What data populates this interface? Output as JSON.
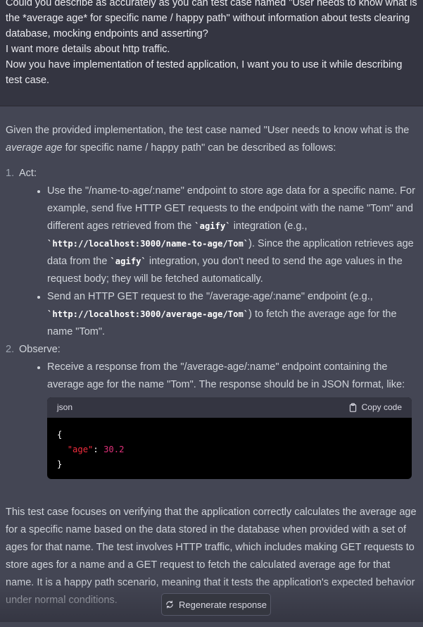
{
  "user_message": {
    "lines": [
      "Could you describe as accurately as you can test case named \"User needs to know what is the *average age* for specific name / happy path\" without information about tests clearing database, mocking endpoints and asserting?",
      "I want more details about http traffic.",
      "Now you have implementation of tested application, I want you to use it while describing test case."
    ]
  },
  "assistant": {
    "intro_before": "Given the provided implementation, the test case named \"User needs to know what is the ",
    "intro_em": "average age",
    "intro_after": " for specific name / happy path\" can be described as follows:",
    "steps": [
      {
        "number": "1.",
        "title": "Act:",
        "bullets": [
          {
            "t1": "Use the \"/name-to-age/:name\" endpoint to store age data for a specific name. For example, send five HTTP GET requests to the endpoint with the name \"Tom\" and different ages retrieved from the ",
            "c1": "`agify`",
            "t2": " integration (e.g., ",
            "c2": "`http://localhost:3000/name-to-age/Tom`",
            "t3": "). Since the application retrieves age data from the ",
            "c3": "`agify`",
            "t4": " integration, you don't need to send the age values in the request body; they will be fetched automatically."
          },
          {
            "t1": "Send an HTTP GET request to the \"/average-age/:name\" endpoint (e.g., ",
            "c1": "`http://localhost:3000/average-age/Tom`",
            "t2": ") to fetch the average age for the name \"Tom\"."
          }
        ]
      },
      {
        "number": "2.",
        "title": "Observe:",
        "bullets": [
          {
            "t1": "Receive a response from the \"/average-age/:name\" endpoint containing the average age for the name \"Tom\". The response should be in JSON format, like:"
          }
        ]
      }
    ],
    "code": {
      "language": "json",
      "copy_label": "Copy code",
      "open_brace": "{",
      "key": "\"age\"",
      "colon": ": ",
      "value": "30.2",
      "close_brace": "}"
    },
    "summary": "This test case focuses on verifying that the application correctly calculates the average age for a specific name based on the data stored in the database when provided with a set of ages for that name. The test involves HTTP traffic, which includes making GET requests to store ages for a name and a GET request to fetch the calculated average age for that name. It is a happy path scenario, meaning that it tests the application's expected behavior under normal conditions."
  },
  "regenerate_label": "Regenerate response",
  "icons": {
    "copy": "clipboard-icon",
    "regenerate": "refresh-icon"
  }
}
